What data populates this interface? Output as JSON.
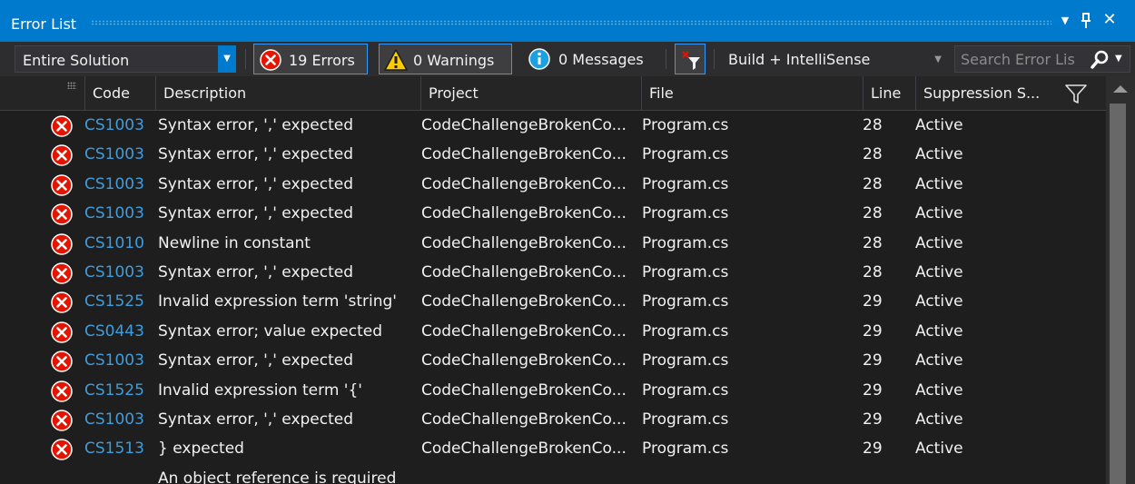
{
  "window": {
    "title": "Error List",
    "dropdown_glyph": "▼",
    "pin_glyph": "ᛘ",
    "close_glyph": "✕"
  },
  "toolbar": {
    "scope_value": "Entire Solution",
    "errors_label": "19 Errors",
    "warnings_label": "0 Warnings",
    "messages_label": "0 Messages",
    "source_value": "Build + IntelliSense",
    "search_placeholder": "Search Error Lis"
  },
  "columns": {
    "code": "Code",
    "description": "Description",
    "project": "Project",
    "file": "File",
    "line": "Line",
    "suppression": "Suppression S..."
  },
  "rows": [
    {
      "code": "CS1003",
      "description": "Syntax error, ',' expected",
      "project": "CodeChallengeBrokenCo...",
      "file": "Program.cs",
      "line": "28",
      "suppression": "Active"
    },
    {
      "code": "CS1003",
      "description": "Syntax error, ',' expected",
      "project": "CodeChallengeBrokenCo...",
      "file": "Program.cs",
      "line": "28",
      "suppression": "Active"
    },
    {
      "code": "CS1003",
      "description": "Syntax error, ',' expected",
      "project": "CodeChallengeBrokenCo...",
      "file": "Program.cs",
      "line": "28",
      "suppression": "Active"
    },
    {
      "code": "CS1003",
      "description": "Syntax error, ',' expected",
      "project": "CodeChallengeBrokenCo...",
      "file": "Program.cs",
      "line": "28",
      "suppression": "Active"
    },
    {
      "code": "CS1010",
      "description": "Newline in constant",
      "project": "CodeChallengeBrokenCo...",
      "file": "Program.cs",
      "line": "28",
      "suppression": "Active"
    },
    {
      "code": "CS1003",
      "description": "Syntax error, ',' expected",
      "project": "CodeChallengeBrokenCo...",
      "file": "Program.cs",
      "line": "28",
      "suppression": "Active"
    },
    {
      "code": "CS1525",
      "description": "Invalid expression term 'string'",
      "project": "CodeChallengeBrokenCo...",
      "file": "Program.cs",
      "line": "29",
      "suppression": "Active"
    },
    {
      "code": "CS0443",
      "description": "Syntax error; value expected",
      "project": "CodeChallengeBrokenCo...",
      "file": "Program.cs",
      "line": "29",
      "suppression": "Active"
    },
    {
      "code": "CS1003",
      "description": "Syntax error, ',' expected",
      "project": "CodeChallengeBrokenCo...",
      "file": "Program.cs",
      "line": "29",
      "suppression": "Active"
    },
    {
      "code": "CS1525",
      "description": "Invalid expression term '{'",
      "project": "CodeChallengeBrokenCo...",
      "file": "Program.cs",
      "line": "29",
      "suppression": "Active"
    },
    {
      "code": "CS1003",
      "description": "Syntax error, ',' expected",
      "project": "CodeChallengeBrokenCo...",
      "file": "Program.cs",
      "line": "29",
      "suppression": "Active"
    },
    {
      "code": "CS1513",
      "description": "} expected",
      "project": "CodeChallengeBrokenCo...",
      "file": "Program.cs",
      "line": "29",
      "suppression": "Active"
    },
    {
      "code": "",
      "description": "An object reference is required",
      "project": "",
      "file": "",
      "line": "",
      "suppression": ""
    }
  ],
  "colors": {
    "accent": "#007acc",
    "error_red": "#e51400",
    "warning_yellow": "#ffcc00",
    "info_blue": "#1ba1e2",
    "code_link": "#3e9ddd"
  },
  "icons": {
    "error": "error-circle-icon",
    "warning": "warning-triangle-icon",
    "info": "info-circle-icon",
    "search": "search-icon",
    "filter": "funnel-icon"
  }
}
